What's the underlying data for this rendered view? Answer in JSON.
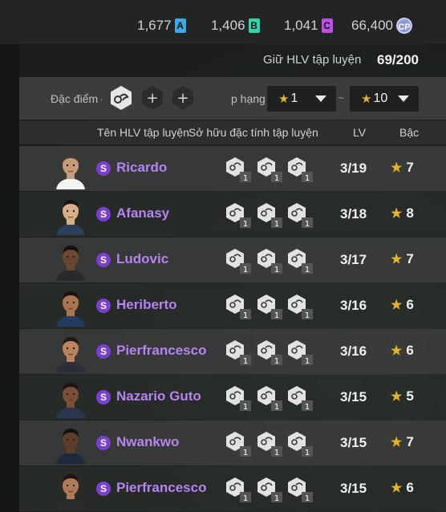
{
  "currencies": [
    {
      "value": "1,677",
      "badge": "A",
      "color": "#3aa9e8"
    },
    {
      "value": "1,406",
      "badge": "B",
      "color": "#2fd6a8"
    },
    {
      "value": "1,041",
      "badge": "C",
      "color": "#c04de8"
    },
    {
      "value": "66,400",
      "badge": "CP",
      "color": "#8a98d8"
    }
  ],
  "header": {
    "label": "Giữ HLV tập luyện",
    "count": "69/200"
  },
  "filter": {
    "trait_label": "Đặc điểm c",
    "add_symbol": "+",
    "rank_label": "p hạng",
    "rank_from": "1",
    "rank_to": "10",
    "tilde": "~"
  },
  "columns": {
    "name": "Tên HLV tập luyện",
    "traits": "Sở hữu đặc tính tập luyện",
    "lv": "LV",
    "grade": "Bậc"
  },
  "trait_level": "1",
  "rows": [
    {
      "name": "Ricardo",
      "lv": "3/19",
      "grade": "7",
      "traits": [
        "pass-icon",
        "power-icon",
        "dribble-icon"
      ]
    },
    {
      "name": "Afanasy",
      "lv": "3/18",
      "grade": "8",
      "traits": [
        "header-icon",
        "dribble-icon",
        "team-icon"
      ]
    },
    {
      "name": "Ludovic",
      "lv": "3/17",
      "grade": "7",
      "traits": [
        "goalkeeper-icon",
        "defense-icon",
        "dribble-icon"
      ]
    },
    {
      "name": "Heriberto",
      "lv": "3/16",
      "grade": "6",
      "traits": [
        "goalkeeper-icon",
        "dribble-icon",
        "shooting-icon"
      ]
    },
    {
      "name": "Pierfrancesco",
      "lv": "3/16",
      "grade": "6",
      "traits": [
        "header-icon",
        "dribble-icon",
        "shooting-icon"
      ]
    },
    {
      "name": "Nazario Guto",
      "lv": "3/15",
      "grade": "5",
      "traits": [
        "pass-icon",
        "dribble-icon",
        "shooting-icon"
      ]
    },
    {
      "name": "Nwankwo",
      "lv": "3/15",
      "grade": "7",
      "traits": [
        "strength-icon",
        "dribble-icon",
        "speed-icon"
      ]
    },
    {
      "name": "Pierfrancesco",
      "lv": "3/15",
      "grade": "6",
      "traits": [
        "dribble-icon",
        "power-icon",
        "shooting-icon"
      ]
    }
  ]
}
